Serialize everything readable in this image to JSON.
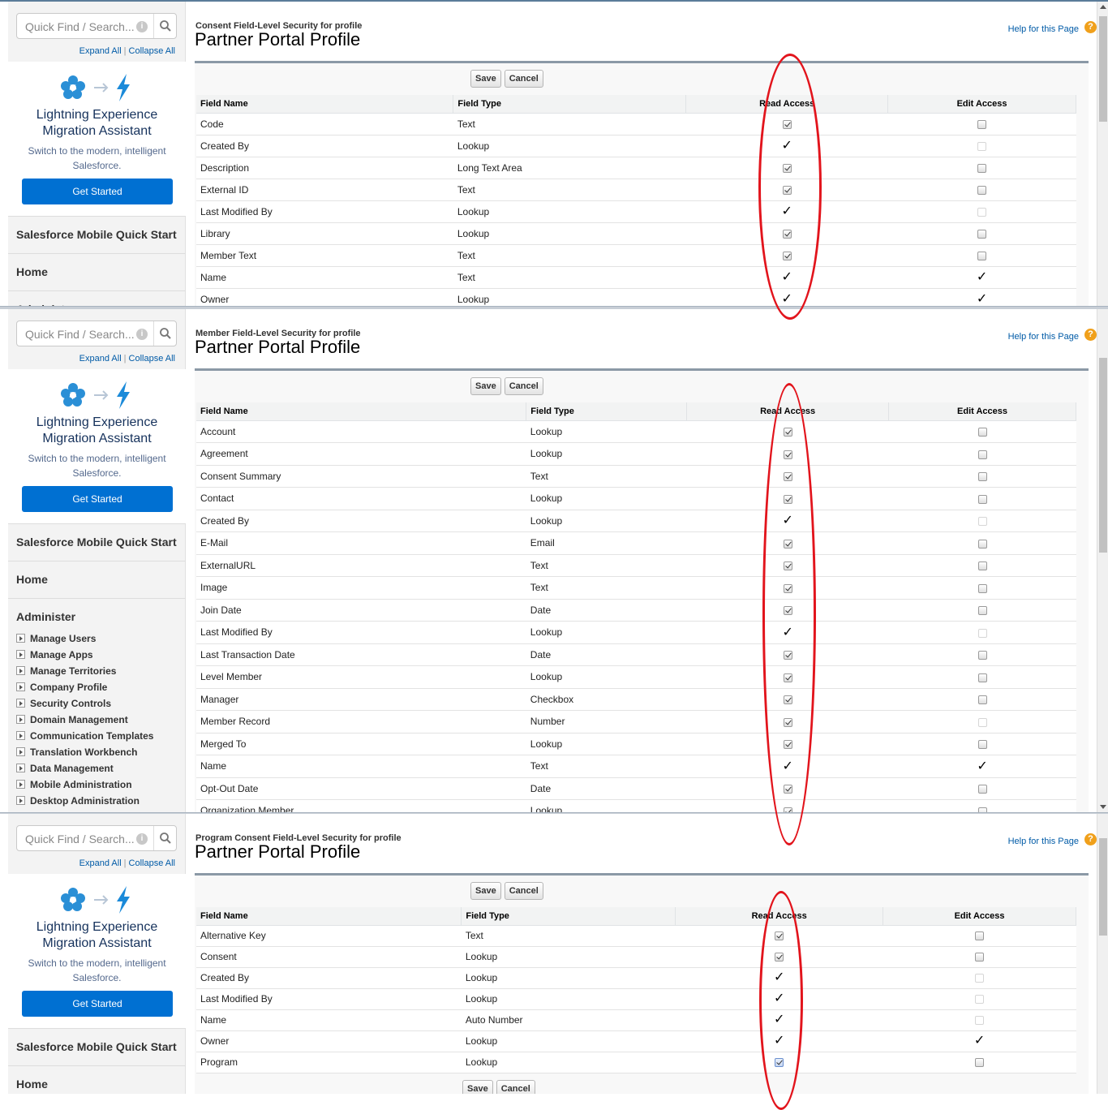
{
  "common": {
    "search_placeholder": "Quick Find / Search...",
    "expand_all": "Expand All",
    "collapse_all": "Collapse All",
    "promo_title_line1": "Lightning Experience",
    "promo_title_line2": "Migration Assistant",
    "promo_sub_line1": "Switch to the modern, intelligent",
    "promo_sub_line2": "Salesforce.",
    "promo_button": "Get Started",
    "mobile_quick_start": "Salesforce Mobile Quick Start",
    "home": "Home",
    "administer": "Administer",
    "administer_cut": "Administ",
    "page_title": "Partner Portal Profile",
    "help_link": "Help for this Page",
    "save": "Save",
    "cancel": "Cancel",
    "col_field_name": "Field Name",
    "col_field_type": "Field Type",
    "col_read_access": "Read Access",
    "col_edit_access": "Edit Access"
  },
  "admin_items": [
    "Manage Users",
    "Manage Apps",
    "Manage Territories",
    "Company Profile",
    "Security Controls",
    "Domain Management",
    "Communication Templates",
    "Translation Workbench",
    "Data Management",
    "Mobile Administration",
    "Desktop Administration"
  ],
  "colors": {
    "brand_blue": "#0070d2",
    "annotation_red": "#e2141c",
    "link": "#015ba7"
  },
  "panels": [
    {
      "pre_title": "Consent Field-Level Security for profile",
      "rows": [
        {
          "name": "Code",
          "type": "Text",
          "read": "checked",
          "edit": "unchecked"
        },
        {
          "name": "Created By",
          "type": "Lookup",
          "read": "tick",
          "edit": "disabled"
        },
        {
          "name": "Description",
          "type": "Long Text Area",
          "read": "checked",
          "edit": "unchecked"
        },
        {
          "name": "External ID",
          "type": "Text",
          "read": "checked",
          "edit": "unchecked"
        },
        {
          "name": "Last Modified By",
          "type": "Lookup",
          "read": "tick",
          "edit": "disabled"
        },
        {
          "name": "Library",
          "type": "Lookup",
          "read": "checked",
          "edit": "unchecked"
        },
        {
          "name": "Member Text",
          "type": "Text",
          "read": "checked",
          "edit": "unchecked"
        },
        {
          "name": "Name",
          "type": "Text",
          "read": "tick",
          "edit": "tick"
        },
        {
          "name": "Owner",
          "type": "Lookup",
          "read": "tick",
          "edit": "tick"
        }
      ]
    },
    {
      "pre_title": "Member Field-Level Security for profile",
      "rows": [
        {
          "name": "Account",
          "type": "Lookup",
          "read": "checked",
          "edit": "unchecked"
        },
        {
          "name": "Agreement",
          "type": "Lookup",
          "read": "checked",
          "edit": "unchecked"
        },
        {
          "name": "Consent Summary",
          "type": "Text",
          "read": "checked",
          "edit": "unchecked"
        },
        {
          "name": "Contact",
          "type": "Lookup",
          "read": "checked",
          "edit": "unchecked"
        },
        {
          "name": "Created By",
          "type": "Lookup",
          "read": "tick",
          "edit": "disabled"
        },
        {
          "name": "E-Mail",
          "type": "Email",
          "read": "checked",
          "edit": "unchecked"
        },
        {
          "name": "ExternalURL",
          "type": "Text",
          "read": "checked",
          "edit": "unchecked"
        },
        {
          "name": "Image",
          "type": "Text",
          "read": "checked",
          "edit": "unchecked"
        },
        {
          "name": "Join Date",
          "type": "Date",
          "read": "checked",
          "edit": "unchecked"
        },
        {
          "name": "Last Modified By",
          "type": "Lookup",
          "read": "tick",
          "edit": "disabled"
        },
        {
          "name": "Last Transaction Date",
          "type": "Date",
          "read": "checked",
          "edit": "unchecked"
        },
        {
          "name": "Level Member",
          "type": "Lookup",
          "read": "checked",
          "edit": "unchecked"
        },
        {
          "name": "Manager",
          "type": "Checkbox",
          "read": "checked",
          "edit": "unchecked"
        },
        {
          "name": "Member Record",
          "type": "Number",
          "read": "checked",
          "edit": "disabled"
        },
        {
          "name": "Merged To",
          "type": "Lookup",
          "read": "checked",
          "edit": "unchecked"
        },
        {
          "name": "Name",
          "type": "Text",
          "read": "tick",
          "edit": "tick"
        },
        {
          "name": "Opt-Out Date",
          "type": "Date",
          "read": "checked",
          "edit": "unchecked"
        },
        {
          "name": "Organization Member",
          "type": "Lookup",
          "read": "checked",
          "edit": "unchecked"
        }
      ]
    },
    {
      "pre_title": "Program Consent Field-Level Security for profile",
      "rows": [
        {
          "name": "Alternative Key",
          "type": "Text",
          "read": "checked",
          "edit": "unchecked"
        },
        {
          "name": "Consent",
          "type": "Lookup",
          "read": "checked",
          "edit": "unchecked"
        },
        {
          "name": "Created By",
          "type": "Lookup",
          "read": "tick",
          "edit": "disabled"
        },
        {
          "name": "Last Modified By",
          "type": "Lookup",
          "read": "tick",
          "edit": "disabled"
        },
        {
          "name": "Name",
          "type": "Auto Number",
          "read": "tick",
          "edit": "disabled"
        },
        {
          "name": "Owner",
          "type": "Lookup",
          "read": "tick",
          "edit": "tick"
        },
        {
          "name": "Program",
          "type": "Lookup",
          "read": "focused",
          "edit": "unchecked"
        }
      ]
    }
  ]
}
